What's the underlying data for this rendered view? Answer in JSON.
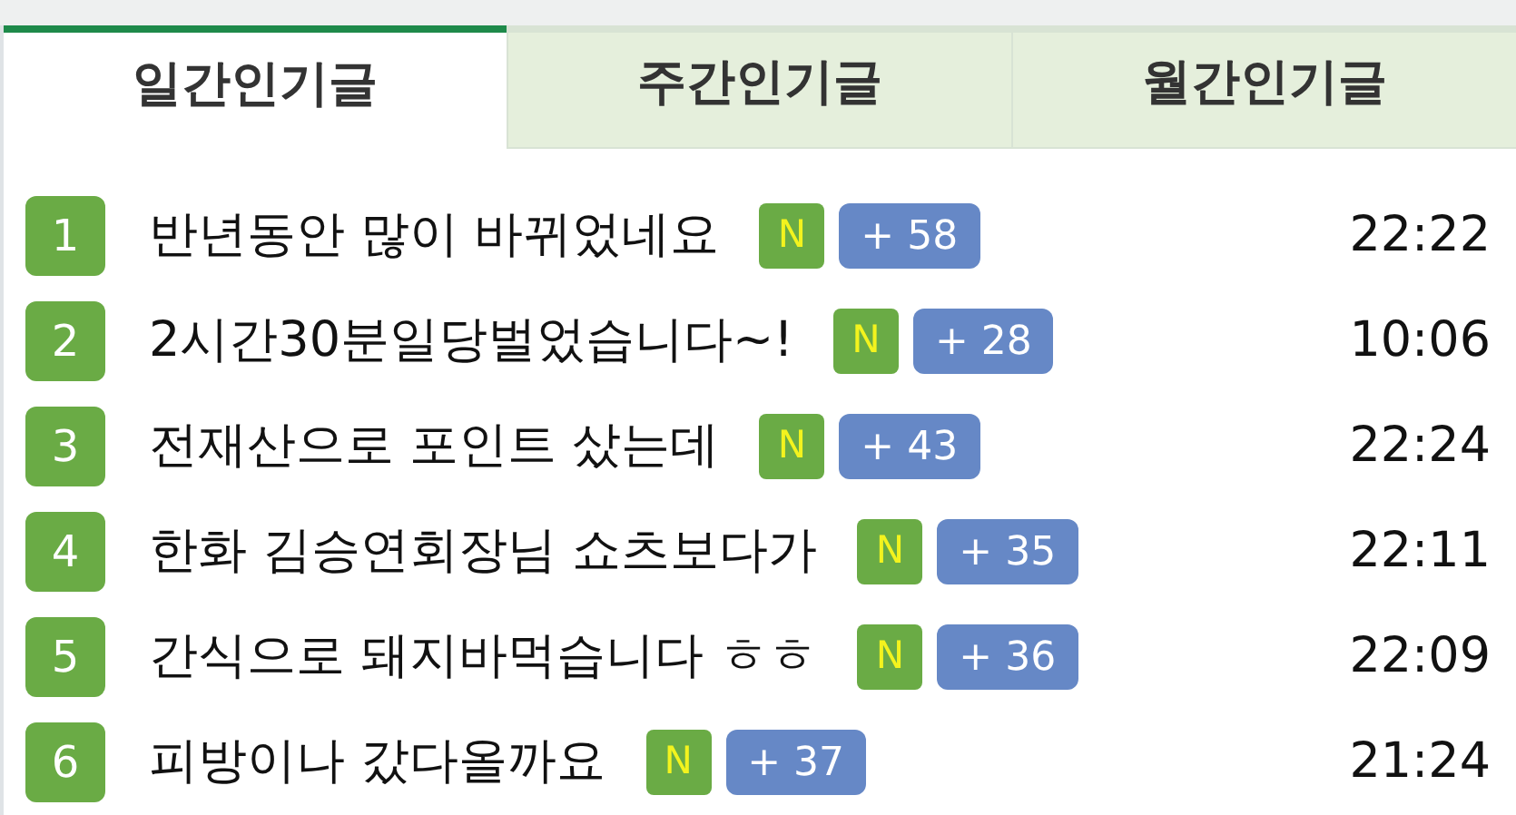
{
  "tabs": [
    {
      "label": "일간인기글",
      "selected": true
    },
    {
      "label": "주간인기글",
      "selected": false
    },
    {
      "label": "월간인기글",
      "selected": false
    }
  ],
  "posts": [
    {
      "rank": "1",
      "title": "반년동안 많이 바뀌었네요",
      "new": true,
      "new_badge": "N",
      "comments": "+ 58",
      "time": "22:22"
    },
    {
      "rank": "2",
      "title": "2시간30분일당벌었습니다~!",
      "new": true,
      "new_badge": "N",
      "comments": "+ 28",
      "time": "10:06"
    },
    {
      "rank": "3",
      "title": "전재산으로 포인트 샀는데",
      "new": true,
      "new_badge": "N",
      "comments": "+ 43",
      "time": "22:24"
    },
    {
      "rank": "4",
      "title": "한화 김승연회장님 쇼츠보다가",
      "new": true,
      "new_badge": "N",
      "comments": "+ 35",
      "time": "22:11"
    },
    {
      "rank": "5",
      "title": "간식으로 돼지바먹습니다 ㅎㅎ",
      "new": true,
      "new_badge": "N",
      "comments": "+ 36",
      "time": "22:09"
    },
    {
      "rank": "6",
      "title": "피방이나 갔다올까요",
      "new": true,
      "new_badge": "N",
      "comments": "+ 37",
      "time": "21:24"
    }
  ]
}
